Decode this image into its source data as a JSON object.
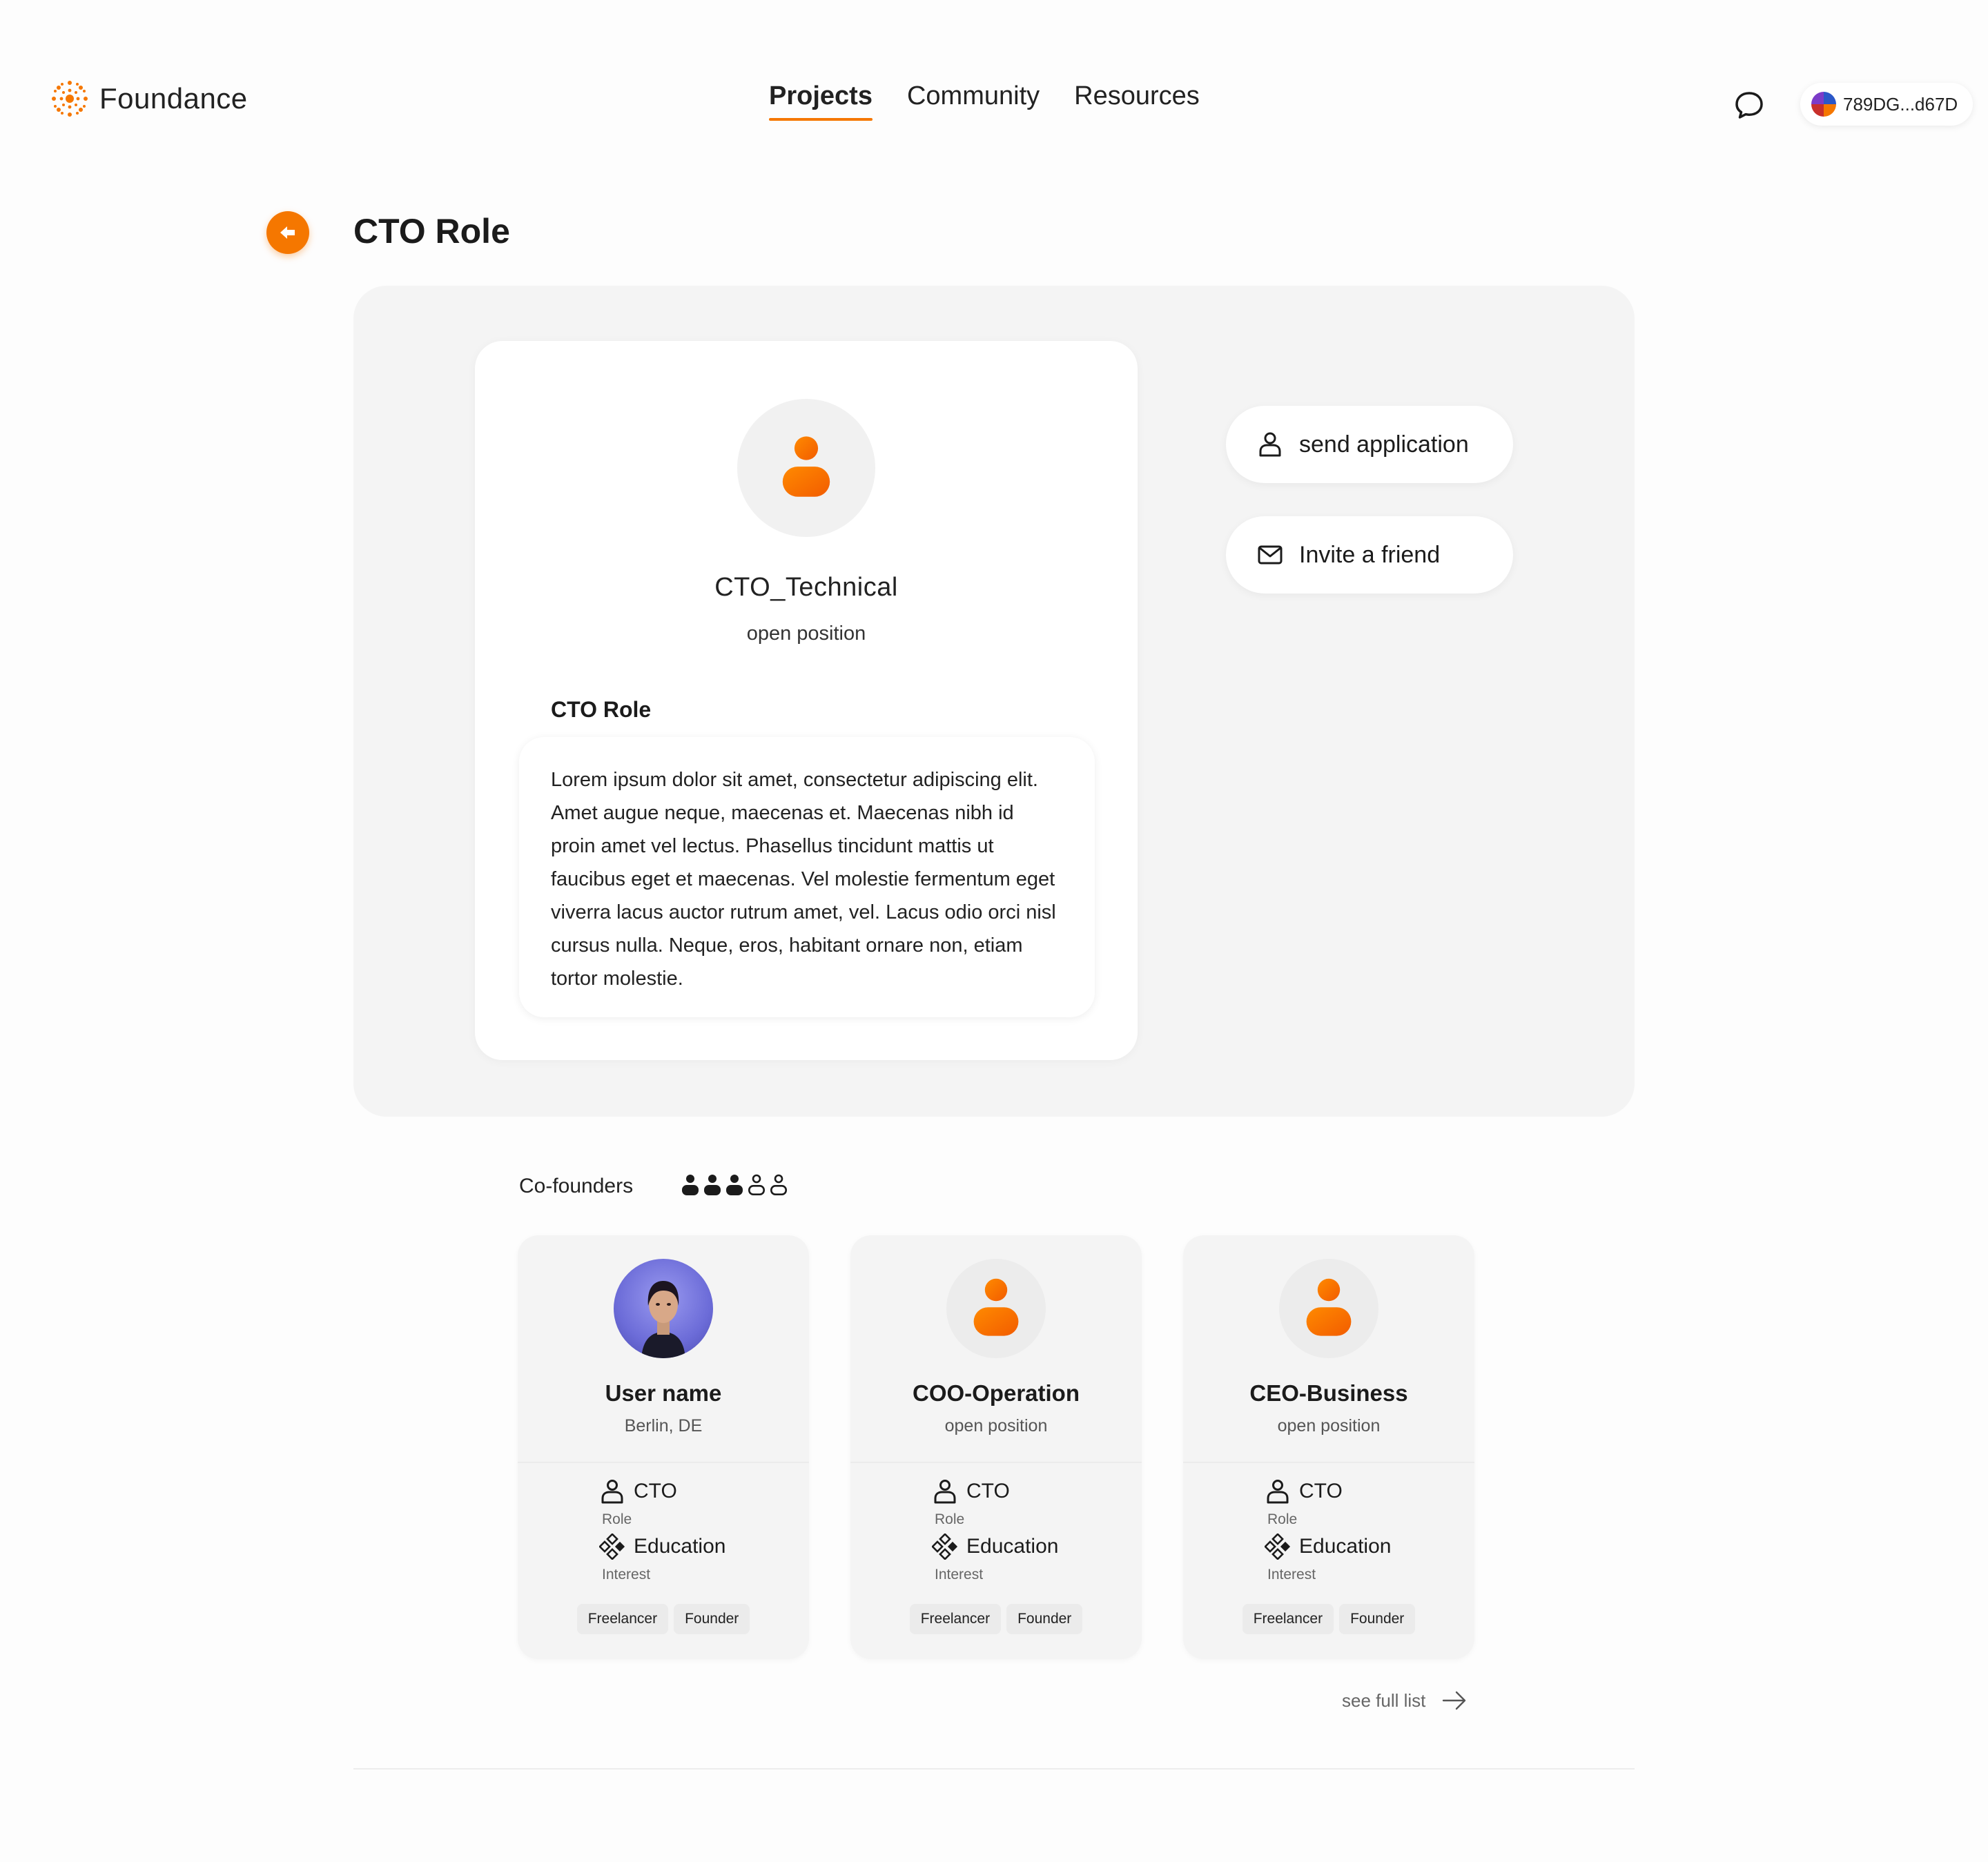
{
  "header": {
    "logo_text": "Foundance",
    "logo_icon": "sun-dots-icon",
    "nav": [
      {
        "label": "Projects",
        "active": true
      },
      {
        "label": "Community",
        "active": false
      },
      {
        "label": "Resources",
        "active": false
      }
    ],
    "chat_icon": "chat-bubble-icon",
    "wallet_address": "789DG...d67D"
  },
  "page": {
    "title": "CTO Role",
    "back_icon": "arrow-left-icon"
  },
  "role_card": {
    "name": "CTO_Technical",
    "status": "open position",
    "heading": "CTO Role",
    "description": "Lorem ipsum dolor sit amet, consectetur adipiscing elit. Amet augue neque, maecenas et. Maecenas nibh id proin amet vel lectus. Phasellus tincidunt mattis ut faucibus eget et maecenas. Vel molestie fermentum eget viverra lacus auctor rutrum amet, vel. Lacus odio orci nisl cursus nulla. Neque, eros, habitant ornare non, etiam tortor molestie."
  },
  "actions": {
    "send_label": "send application",
    "invite_label": "Invite a friend"
  },
  "cofounders": {
    "label": "Co-founders",
    "slots": [
      {
        "filled": true
      },
      {
        "filled": true
      },
      {
        "filled": true
      },
      {
        "filled": false
      },
      {
        "filled": false
      }
    ],
    "members": [
      {
        "name": "User name",
        "subtitle": "Berlin, DE",
        "role_value": "CTO",
        "role_caption": "Role",
        "interest_value": "Education",
        "interest_caption": "Interest",
        "tags": [
          "Freelancer",
          "Founder"
        ],
        "has_photo": true
      },
      {
        "name": "COO-Operation",
        "subtitle": "open position",
        "role_value": "CTO",
        "role_caption": "Role",
        "interest_value": "Education",
        "interest_caption": "Interest",
        "tags": [
          "Freelancer",
          "Founder"
        ],
        "has_photo": false
      },
      {
        "name": "CEO-Business",
        "subtitle": "open position",
        "role_value": "CTO",
        "role_caption": "Role",
        "interest_value": "Education",
        "interest_caption": "Interest",
        "tags": [
          "Freelancer",
          "Founder"
        ],
        "has_photo": false
      }
    ],
    "see_full_label": "see full list"
  },
  "colors": {
    "accent": "#f57700",
    "panel_bg": "#f4f4f4",
    "text": "#1b1b1b"
  }
}
